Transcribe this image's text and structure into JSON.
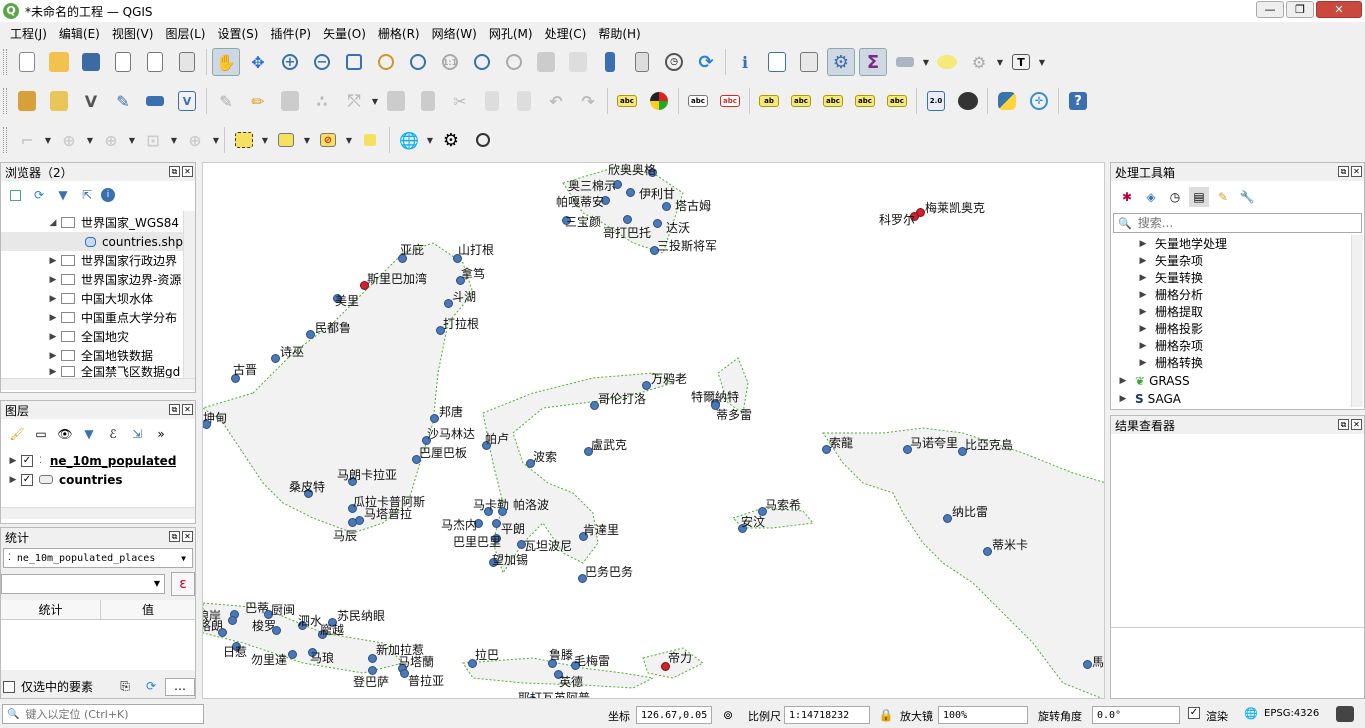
{
  "window": {
    "title": "*未命名的工程 — QGIS",
    "controls": [
      "—",
      "❐",
      "✕"
    ]
  },
  "menu": [
    "工程(J)",
    "编辑(E)",
    "视图(V)",
    "图层(L)",
    "设置(S)",
    "插件(P)",
    "矢量(O)",
    "栅格(R)",
    "网络(W)",
    "网孔(M)",
    "处理(C)",
    "帮助(H)"
  ],
  "browser": {
    "title": "浏览器（2）",
    "items": [
      {
        "label": "世界国家_WGS84",
        "expanded": true,
        "level": 1
      },
      {
        "label": "countries.shp",
        "level": 2
      },
      {
        "label": "世界国家行政边界",
        "level": 1
      },
      {
        "label": "世界国家边界-资源",
        "level": 1
      },
      {
        "label": "中国大坝水体",
        "level": 1
      },
      {
        "label": "中国重点大学分布",
        "level": 1
      },
      {
        "label": "全国地灾",
        "level": 1
      },
      {
        "label": "全国地铁数据",
        "level": 1
      },
      {
        "label": "全国禁飞区数据gd",
        "level": 1
      }
    ]
  },
  "layers": {
    "title": "图层",
    "items": [
      {
        "label": "ne_10m_populated",
        "checked": true,
        "bold": true
      },
      {
        "label": "countries",
        "checked": true,
        "bold": true
      }
    ]
  },
  "stats": {
    "title": "统计",
    "layer": "ne_10m_populated_places",
    "field": "",
    "expr_icon": "ε",
    "col_stat": "统计",
    "col_value": "值",
    "selected_only": "仅选中的要素",
    "more": "…"
  },
  "toolbox": {
    "title": "处理工具箱",
    "search_placeholder": "搜索...",
    "items": [
      "矢量地学处理",
      "矢量杂项",
      "矢量转换",
      "栅格分析",
      "栅格提取",
      "栅格投影",
      "栅格杂项",
      "栅格转换"
    ],
    "providers": [
      "GRASS",
      "SAGA"
    ]
  },
  "results": {
    "title": "结果查看器"
  },
  "locator": {
    "placeholder": "键入以定位 (Ctrl+K)"
  },
  "status": {
    "coord_label": "坐标",
    "coord_value": "126.67,0.05",
    "scale_label": "比例尺",
    "scale_value": "1:14718232",
    "magnifier_label": "放大镜",
    "magnifier_value": "100%",
    "rotation_label": "旋转角度",
    "rotation_value": "0.0°",
    "render_label": "渲染",
    "epsg": "EPSG:4326"
  },
  "map": {
    "cities": [
      {
        "name": "欣奥奥格",
        "red": false
      },
      {
        "name": "奥三棉示",
        "red": false
      },
      {
        "name": "伊利甘",
        "red": false
      },
      {
        "name": "帕嘎蒂安",
        "red": false
      },
      {
        "name": "塔古姆",
        "red": false
      },
      {
        "name": "三宝颜",
        "red": false
      },
      {
        "name": "哥打巴托",
        "red": false
      },
      {
        "name": "达沃",
        "red": false
      },
      {
        "name": "三投斯将军",
        "red": false
      },
      {
        "name": "梅莱凯奥克",
        "red": true
      },
      {
        "name": "科罗尔",
        "red": true
      },
      {
        "name": "亚庇",
        "red": false
      },
      {
        "name": "山打根",
        "red": false
      },
      {
        "name": "斯里巴加湾",
        "red": true
      },
      {
        "name": "拿笃",
        "red": false
      },
      {
        "name": "美里",
        "red": false
      },
      {
        "name": "斗湖",
        "red": false
      },
      {
        "name": "民都鲁",
        "red": false
      },
      {
        "name": "打拉根",
        "red": false
      },
      {
        "name": "诗巫",
        "red": false
      },
      {
        "name": "古晋",
        "red": false
      },
      {
        "name": "万鸦老",
        "red": false
      },
      {
        "name": "哥伦打洛",
        "red": false
      },
      {
        "name": "特爾納特",
        "red": false
      },
      {
        "name": "蒂多雷",
        "red": false
      },
      {
        "name": "坤甸",
        "red": false
      },
      {
        "name": "邦唐",
        "red": false
      },
      {
        "name": "沙马林达",
        "red": false
      },
      {
        "name": "巴厘巴板",
        "red": false
      },
      {
        "name": "帕卢",
        "red": false
      },
      {
        "name": "波索",
        "red": false
      },
      {
        "name": "盧武克",
        "red": false
      },
      {
        "name": "索龍",
        "red": false
      },
      {
        "name": "马诺夸里",
        "red": false
      },
      {
        "name": "比亞克島",
        "red": false
      },
      {
        "name": "马朗卡拉亚",
        "red": false
      },
      {
        "name": "桑皮特",
        "red": false
      },
      {
        "name": "瓜拉卡普阿斯",
        "red": false
      },
      {
        "name": "马塔普拉",
        "red": false
      },
      {
        "name": "马辰",
        "red": false
      },
      {
        "name": "马卡勒",
        "red": false
      },
      {
        "name": "帕洛波",
        "red": false
      },
      {
        "name": "马杰内",
        "red": false
      },
      {
        "name": "平朗",
        "red": false
      },
      {
        "name": "巴里巴里",
        "red": false
      },
      {
        "name": "瓦坦波尼",
        "red": false
      },
      {
        "name": "望加锡",
        "red": false
      },
      {
        "name": "肯達里",
        "red": false
      },
      {
        "name": "巴务巴务",
        "red": false
      },
      {
        "name": "马索希",
        "red": false
      },
      {
        "name": "安汶",
        "red": false
      },
      {
        "name": "纳比雷",
        "red": false
      },
      {
        "name": "蒂米卡",
        "red": false
      },
      {
        "name": "苏民纳眼",
        "red": false
      },
      {
        "name": "新加拉惹",
        "red": false
      },
      {
        "name": "拉巴",
        "red": false
      },
      {
        "name": "鲁滕",
        "red": false
      },
      {
        "name": "毛梅雷",
        "red": false
      },
      {
        "name": "帝力",
        "red": true
      },
      {
        "name": "英德",
        "red": false
      },
      {
        "name": "登巴萨",
        "red": false
      },
      {
        "name": "马塔蘭",
        "red": false
      },
      {
        "name": "普拉亚",
        "red": false
      },
      {
        "name": "巴蒂",
        "red": false
      },
      {
        "name": "厨闽",
        "red": false
      },
      {
        "name": "泗水",
        "red": false
      },
      {
        "name": "格朗",
        "red": false
      },
      {
        "name": "梭罗",
        "red": false
      },
      {
        "name": "龐越",
        "red": false
      },
      {
        "name": "日惹",
        "red": false
      },
      {
        "name": "勿里達",
        "red": false
      },
      {
        "name": "马琅",
        "red": false
      },
      {
        "name": "琅岸",
        "red": false
      },
      {
        "name": "馬",
        "red": false
      },
      {
        "name": "耶打瓦英阿普",
        "red": false
      }
    ]
  }
}
